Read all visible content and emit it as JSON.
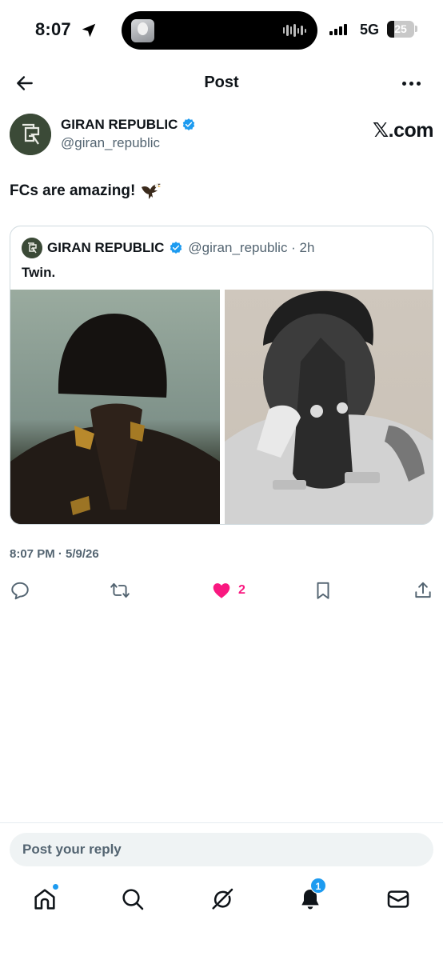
{
  "status_bar": {
    "time": "8:07",
    "network": "5G",
    "battery_percent": "25",
    "battery_level": 0.25
  },
  "header": {
    "title": "Post"
  },
  "post": {
    "author_name": "GIRAN REPUBLIC",
    "author_handle": "@giran_republic",
    "source": "𝕏.com",
    "text": "FCs are amazing!",
    "emoji": "eagle",
    "timestamp": "8:07 PM · 5/9/26",
    "like_count": "2",
    "liked": true
  },
  "quoted_post": {
    "author_name": "GIRAN REPUBLIC",
    "meta": "@giran_republic · 2h",
    "text": "Twin."
  },
  "reply": {
    "placeholder": "Post your reply"
  },
  "tabbar": {
    "notification_count": "1"
  },
  "colors": {
    "accent": "#1d9bf0",
    "like": "#f91880",
    "text_primary": "#0f1419",
    "text_secondary": "#536471"
  }
}
